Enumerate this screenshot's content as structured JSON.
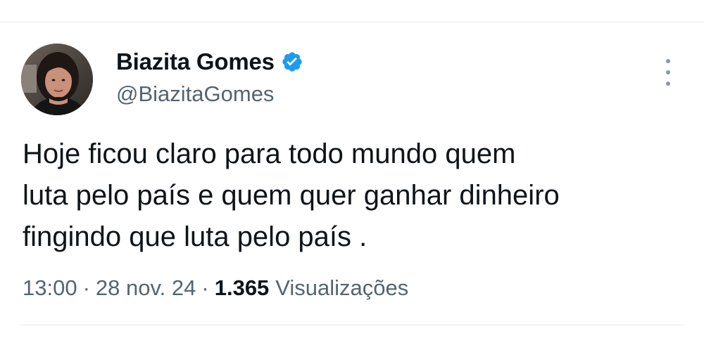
{
  "author": {
    "display_name": "Biazita Gomes",
    "handle": "@BiazitaGomes",
    "verified": true
  },
  "tweet": {
    "lines": [
      "Hoje ficou claro para todo mundo quem",
      "luta pelo país e quem quer ganhar dinheiro",
      "fingindo que luta pelo país ."
    ]
  },
  "meta": {
    "time": "13:00",
    "separator": "·",
    "date": "28 nov. 24",
    "views_count": "1.365",
    "views_label": "Visualizações"
  },
  "colors": {
    "text_primary": "#0f1419",
    "text_secondary": "#536471",
    "verified_badge": "#1d9bf0",
    "divider": "#e6e9ec"
  },
  "icons": {
    "verified": "verified-badge-icon",
    "more": "more-vertical-icon"
  }
}
